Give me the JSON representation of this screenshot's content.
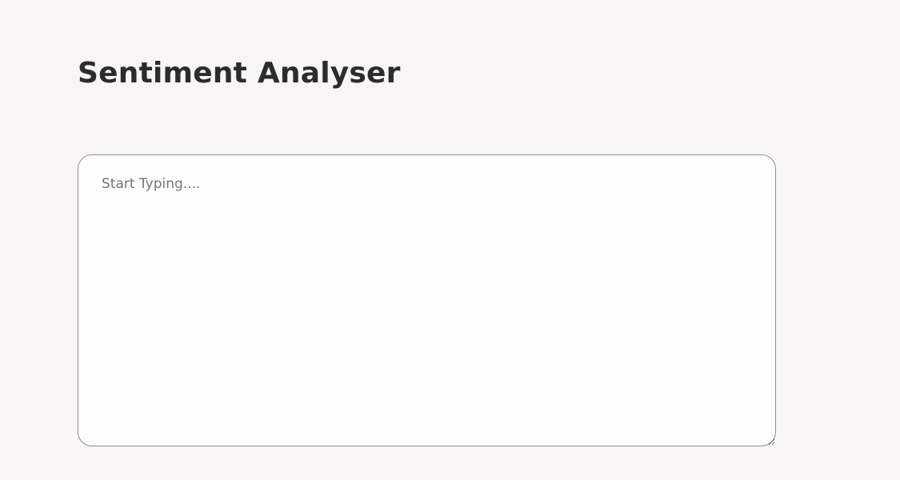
{
  "page": {
    "title": "Sentiment Analyser"
  },
  "editor": {
    "value": "",
    "placeholder": "Start Typing...."
  },
  "colors": {
    "background": "#f8f6f2",
    "editor_background": "#fdfdfc",
    "editor_border": "#8f8f8f",
    "title_text": "#2c2c2c",
    "placeholder_text": "#757575"
  }
}
